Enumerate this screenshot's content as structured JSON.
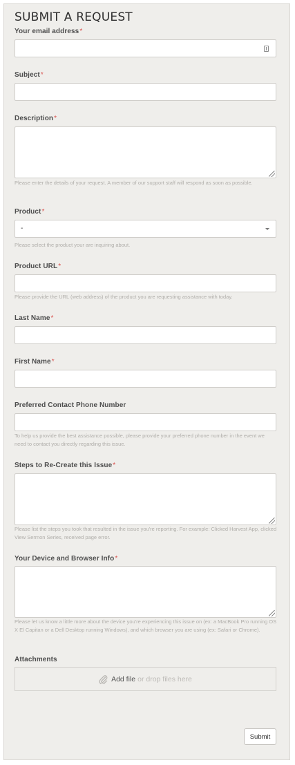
{
  "form": {
    "title": "SUBMIT A REQUEST",
    "required_mark": "*",
    "email": {
      "label": "Your email address",
      "value": ""
    },
    "subject": {
      "label": "Subject",
      "value": ""
    },
    "description": {
      "label": "Description",
      "value": "",
      "hint": "Please enter the details of your request. A member of our support staff will respond as soon as possible."
    },
    "product": {
      "label": "Product",
      "selected": "-",
      "hint": "Please select the product your are inquiring about."
    },
    "product_url": {
      "label": "Product URL",
      "value": "",
      "hint": "Please provide the URL (web address) of the product you are requesting assistance with today."
    },
    "last_name": {
      "label": "Last Name",
      "value": ""
    },
    "first_name": {
      "label": "First Name",
      "value": ""
    },
    "phone": {
      "label": "Preferred Contact Phone Number",
      "value": "",
      "hint": "To help us provide the best assistance possible, please provide your preferred phone number in the event we need to contact you directly regarding this issue."
    },
    "steps": {
      "label": "Steps to Re-Create this Issue",
      "value": "",
      "hint": "Please list the steps you took that resulted in the issue you're reporting. For example: Clicked Harvest App, clicked View Sermon Series, received page error."
    },
    "device": {
      "label": "Your Device and Browser Info",
      "value": "",
      "hint": "Please let us know a little more about the device you're experiencing this issue on (ex: a MacBook Pro running OS X El Capitan or a Dell Desktop running Windows), and which browser you are using (ex: Safari or Chrome)."
    },
    "attachments": {
      "label": "Attachments",
      "add_file": "Add file",
      "drop_text": "or drop files here",
      "icon": "paperclip-icon"
    },
    "submit_label": "Submit"
  },
  "colors": {
    "panel_bg": "#efeeeb",
    "required": "#d9534f",
    "hint_text": "#b0aeaa"
  }
}
